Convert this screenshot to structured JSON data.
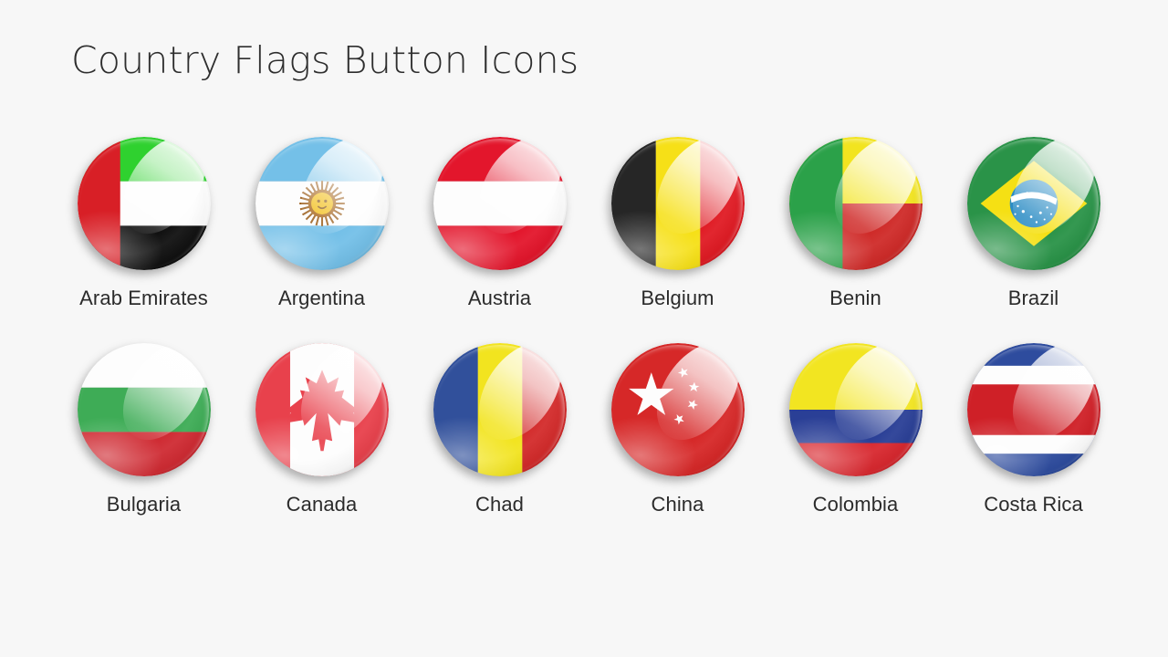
{
  "page": {
    "title": "Country Flags Button Icons",
    "background_color": "#f7f7f7",
    "text_color": "#2b2b2b"
  },
  "grid": {
    "columns": 6,
    "rows": 2
  },
  "flags": [
    {
      "name": "Arab Emirates",
      "icon": "flag-arab-emirates-icon",
      "colors": [
        "#d81f26",
        "#2fd12f",
        "#ffffff",
        "#111111"
      ],
      "design": "vertical red hoist band with green, white and black horizontal stripes"
    },
    {
      "name": "Argentina",
      "icon": "flag-argentina-icon",
      "colors": [
        "#74c0e8",
        "#ffffff",
        "#f2b722",
        "#8a5a1e"
      ],
      "design": "light blue, white and light blue horizontal stripes with the golden Sun of May"
    },
    {
      "name": "Austria",
      "icon": "flag-austria-icon",
      "colors": [
        "#e3162c",
        "#ffffff"
      ],
      "design": "red, white and red horizontal stripes"
    },
    {
      "name": "Belgium",
      "icon": "flag-belgium-icon",
      "colors": [
        "#262626",
        "#f6e017",
        "#e01b24"
      ],
      "design": "black, yellow and red vertical stripes"
    },
    {
      "name": "Benin",
      "icon": "flag-benin-icon",
      "colors": [
        "#2ba149",
        "#f2e41f",
        "#cf2b29"
      ],
      "design": "green vertical hoist band with yellow over red horizontal bands"
    },
    {
      "name": "Brazil",
      "icon": "flag-brazil-icon",
      "colors": [
        "#2a9348",
        "#f5e014",
        "#2b8cc4",
        "#ffffff"
      ],
      "design": "green field with yellow rhombus and blue celestial globe"
    },
    {
      "name": "Bulgaria",
      "icon": "flag-bulgaria-icon",
      "colors": [
        "#ffffff",
        "#3eac56",
        "#cf2b33"
      ],
      "design": "white, green and red horizontal stripes"
    },
    {
      "name": "Canada",
      "icon": "flag-canada-icon",
      "colors": [
        "#e8414c",
        "#ffffff"
      ],
      "design": "red, white and red vertical bands with a red maple leaf"
    },
    {
      "name": "Chad",
      "icon": "flag-chad-icon",
      "colors": [
        "#31509b",
        "#f2e41f",
        "#d32b2b"
      ],
      "design": "blue, yellow and red vertical stripes"
    },
    {
      "name": "China",
      "icon": "flag-china-icon",
      "colors": [
        "#d62828",
        "#ffffff"
      ],
      "design": "red field with one large star and four small stars"
    },
    {
      "name": "Colombia",
      "icon": "flag-colombia-icon",
      "colors": [
        "#f2e521",
        "#2a3f96",
        "#d8282f"
      ],
      "design": "yellow half with blue and red horizontal bands"
    },
    {
      "name": "Costa Rica",
      "icon": "flag-costa-rica-icon",
      "colors": [
        "#2e4c9e",
        "#ffffff",
        "#cf2027"
      ],
      "design": "blue, white, red, white and blue horizontal stripes"
    }
  ]
}
